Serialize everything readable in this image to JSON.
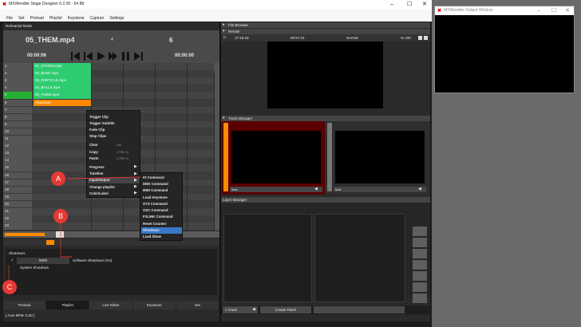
{
  "window": {
    "title": "MXWendler Stage Designer 6.2.00 - 64 Bit",
    "menu": [
      "File",
      "Set",
      "Preload",
      "Playlist",
      "Keystone",
      "Capture",
      "Settings"
    ]
  },
  "output_window": {
    "title": "MXWendler Output Window"
  },
  "left": {
    "mode": "Rehearsal Mode",
    "clip_name": "05_THEM.mp4",
    "clip_index": "4",
    "clip_number": "6",
    "time_left": "00:00:06",
    "time_right": "00:00:00",
    "rows": [
      {
        "num": "1",
        "clip": "01_STADIN.mp4",
        "state": "loaded"
      },
      {
        "num": "2",
        "clip": "02_BASE.mp4",
        "state": "loaded"
      },
      {
        "num": "3",
        "clip": "03_PARTICLE.mp4",
        "state": "loaded"
      },
      {
        "num": "4",
        "clip": "04_BALLS.mp4",
        "state": "loaded"
      },
      {
        "num": "5",
        "clip": "05_THEM.mp4",
        "state": "playing"
      },
      {
        "num": "6",
        "clip": "Shutdown",
        "state": "command"
      },
      {
        "num": "7",
        "clip": "",
        "state": "empty"
      },
      {
        "num": "8",
        "clip": "",
        "state": "empty"
      },
      {
        "num": "9",
        "clip": "",
        "state": "empty"
      },
      {
        "num": "10",
        "clip": "",
        "state": "empty"
      },
      {
        "num": "11",
        "clip": "",
        "state": "empty"
      },
      {
        "num": "12",
        "clip": "",
        "state": "empty"
      },
      {
        "num": "13",
        "clip": "",
        "state": "empty"
      },
      {
        "num": "14",
        "clip": "",
        "state": "empty"
      },
      {
        "num": "15",
        "clip": "",
        "state": "empty"
      },
      {
        "num": "16",
        "clip": "",
        "state": "empty"
      },
      {
        "num": "17",
        "clip": "",
        "state": "empty"
      },
      {
        "num": "18",
        "clip": "",
        "state": "empty"
      },
      {
        "num": "19",
        "clip": "",
        "state": "empty"
      },
      {
        "num": "20",
        "clip": "",
        "state": "empty"
      },
      {
        "num": "21",
        "clip": "",
        "state": "empty"
      },
      {
        "num": "22",
        "clip": "",
        "state": "empty"
      },
      {
        "num": "23",
        "clip": "",
        "state": "empty"
      }
    ],
    "shutdown": {
      "header": "Shutdown:",
      "seconds_value": "5000",
      "seconds_label": "Software Shutdown (ms)",
      "system_label": "System Shutdown"
    },
    "tabs": [
      "Preload",
      "Playlist",
      "Live Editor",
      "Keystone",
      "Set"
    ],
    "active_tab": "Playlist",
    "status": "[ Auto BPM: 0.00 ]"
  },
  "context_menu": {
    "items": [
      {
        "label": "Trigger Clip",
        "shortcut": "",
        "arrow": false,
        "sep_before": false
      },
      {
        "label": "Trigger Subtitle",
        "shortcut": "",
        "arrow": false,
        "sep_before": false
      },
      {
        "label": "Fade Clip",
        "shortcut": "",
        "arrow": false,
        "sep_before": false
      },
      {
        "label": "Stop Clips",
        "shortcut": "",
        "arrow": false,
        "sep_before": false
      },
      {
        "label": "Clear",
        "shortcut": "Del",
        "arrow": false,
        "sep_before": true
      },
      {
        "label": "Copy",
        "shortcut": "CTRL+C",
        "arrow": false,
        "sep_before": false
      },
      {
        "label": "Paste",
        "shortcut": "CTRL+V",
        "arrow": false,
        "sep_before": false
      },
      {
        "label": "Progress",
        "shortcut": "",
        "arrow": true,
        "sep_before": true
      },
      {
        "label": "Timeline",
        "shortcut": "",
        "arrow": true,
        "sep_before": false
      },
      {
        "label": "Input/Output",
        "shortcut": "",
        "arrow": true,
        "sep_before": false,
        "highlight": true
      },
      {
        "label": "Change playlist",
        "shortcut": "",
        "arrow": true,
        "sep_before": false
      },
      {
        "label": "Color/Label",
        "shortcut": "",
        "arrow": true,
        "sep_before": false
      }
    ],
    "submenu": [
      {
        "label": "IO Command"
      },
      {
        "label": "DMX Command"
      },
      {
        "label": "MIDI Command"
      },
      {
        "label": "Load Keystone"
      },
      {
        "label": "SYS Command"
      },
      {
        "label": "OSC Command"
      },
      {
        "label": "PJLINK Command"
      },
      {
        "label": "Reset Counter"
      },
      {
        "label": "Shutdown",
        "highlight": true
      },
      {
        "label": "Load Show"
      }
    ]
  },
  "annotations": [
    "A",
    "B",
    "C"
  ],
  "right": {
    "file_browser": "File Browser",
    "render": "Render",
    "render_time1": "17:15:33",
    "render_time2": "00:57:31",
    "render_mode": "Normal",
    "render_zoom": "% 100",
    "track_manager": "Track Manager",
    "track1_label": "fade",
    "track2_label": "fade",
    "layer_manager": "Layer Manager",
    "layer_track": "1 Track",
    "create_patch": "Create Patch"
  },
  "colors": {
    "accent": "#ff8a00",
    "loaded": "#2ecc71",
    "playing": "#27ae34",
    "annotation": "#e53935",
    "highlight": "#3a78c8"
  }
}
